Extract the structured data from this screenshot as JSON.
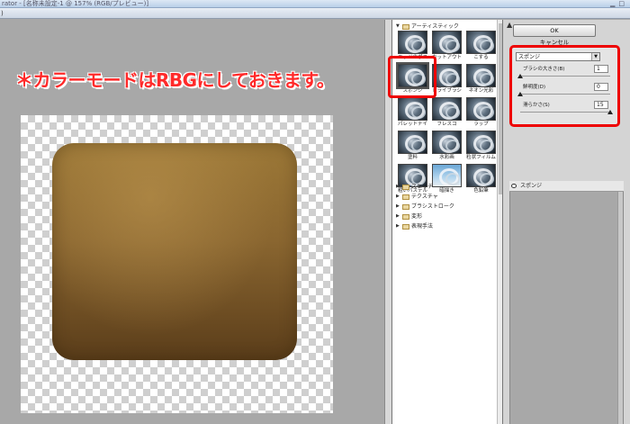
{
  "window": {
    "title": "rator - [名称未設定-1 @ 157% (RGB/プレビュー)]",
    "menu": ")"
  },
  "annotation": "＊カラーモードはRBGにしておきます。",
  "gallery": {
    "category_open": "アーティスティック",
    "thumbnails": [
      {
        "label": "エッジのポスタリゼ",
        "style": "dark"
      },
      {
        "label": "カットアウト",
        "style": "dark"
      },
      {
        "label": "こする",
        "style": "dark"
      },
      {
        "label": "スポンジ",
        "style": "dark"
      },
      {
        "label": "ドライブラシ",
        "style": "dark"
      },
      {
        "label": "ネオン光彩",
        "style": "dark"
      },
      {
        "label": "パレットナイフ",
        "style": "dark"
      },
      {
        "label": "フレスコ",
        "style": "dark"
      },
      {
        "label": "ラップ",
        "style": "dark"
      },
      {
        "label": "塗料",
        "style": "dark"
      },
      {
        "label": "水彩画",
        "style": "dark"
      },
      {
        "label": "粒状フィルム",
        "style": "dark"
      },
      {
        "label": "粗いパステル画",
        "style": "dark"
      },
      {
        "label": "暗描き",
        "style": "sky"
      },
      {
        "label": "色鉛筆",
        "style": "dark"
      }
    ],
    "selected_index": 3,
    "folders": [
      "スケッチ",
      "テクスチャ",
      "ブラシストローク",
      "変形",
      "表現手法"
    ]
  },
  "panel": {
    "ok": "OK",
    "cancel": "キャンセル",
    "filter_select": "スポンジ",
    "params": [
      {
        "label": "ブラシの大きさ(B)",
        "value": "1",
        "fraction": 0.0
      },
      {
        "label": "鮮明度(D)",
        "value": "0",
        "fraction": 0.0
      },
      {
        "label": "滑らかさ(S)",
        "value": "15",
        "fraction": 1.0
      }
    ],
    "layer_name": "スポンジ"
  }
}
